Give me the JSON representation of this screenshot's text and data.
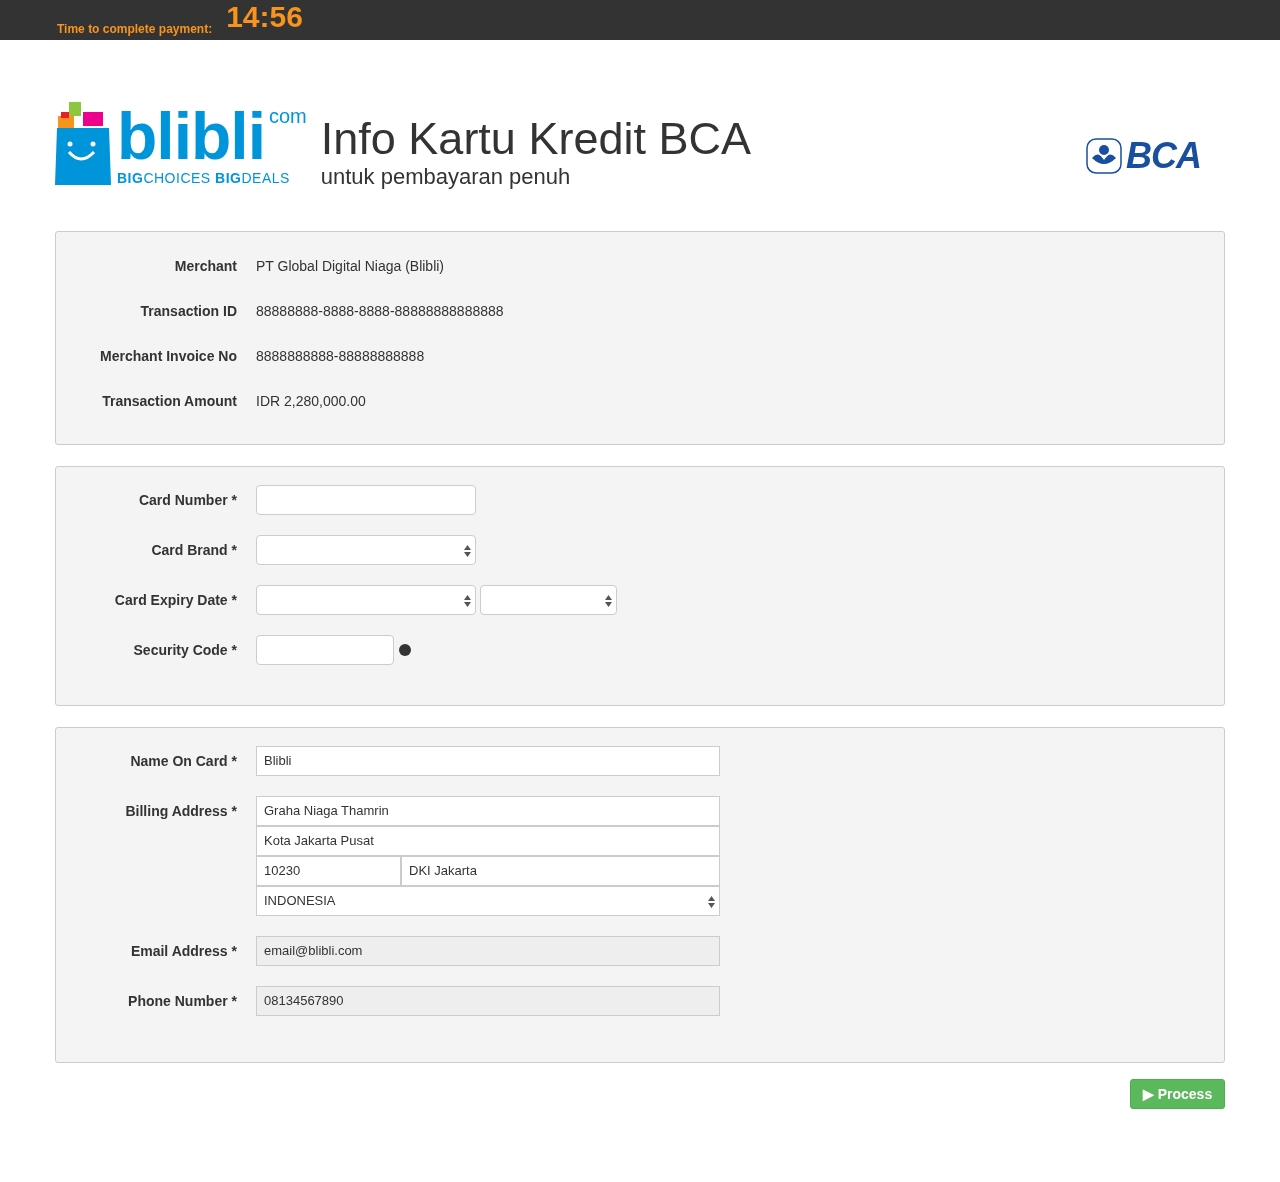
{
  "timer": {
    "label": "Time to complete payment:",
    "time": "14:56"
  },
  "header": {
    "logo": {
      "wordmark": "blibli",
      "suffix": "com",
      "tagline": "**BIG**CHOICES **BIG**DEALS"
    },
    "title": "Info Kartu Kredit BCA",
    "subtitle": "untuk pembayaran penuh",
    "bank_logo": "BCA"
  },
  "summary": [
    {
      "label": "Merchant",
      "value": "PT Global Digital Niaga (Blibli)"
    },
    {
      "label": "Transaction ID",
      "value": "88888888-8888-8888-88888888888888"
    },
    {
      "label": "Merchant Invoice No",
      "value": "8888888888-88888888888"
    },
    {
      "label": "Transaction Amount",
      "value": "IDR 2,280,000.00"
    }
  ],
  "card_fields": [
    {
      "label": "Card Number *",
      "kind": "text"
    },
    {
      "label": "Card Brand *",
      "kind": "select"
    },
    {
      "label": "Card Expiry Date *",
      "kind": "expiry"
    },
    {
      "label": "Security Code *",
      "kind": "cvv"
    }
  ],
  "billing_fields": [
    {
      "label": "Name On Card *",
      "kind": "text",
      "value": "Blibli",
      "disabled": false
    },
    {
      "label": "Billing Address *",
      "kind": "address",
      "lines": [
        "Graha Niaga Thamrin",
        "Kota Jakarta Pusat"
      ],
      "postcode": "10230",
      "province": "DKI Jakarta",
      "country": "INDONESIA"
    },
    {
      "label": "Email Address *",
      "kind": "text",
      "value": "email@blibli.com",
      "disabled": true
    },
    {
      "label": "Phone Number *",
      "kind": "text",
      "value": "08134567890",
      "disabled": true
    }
  ],
  "process_button": "▶ Process"
}
